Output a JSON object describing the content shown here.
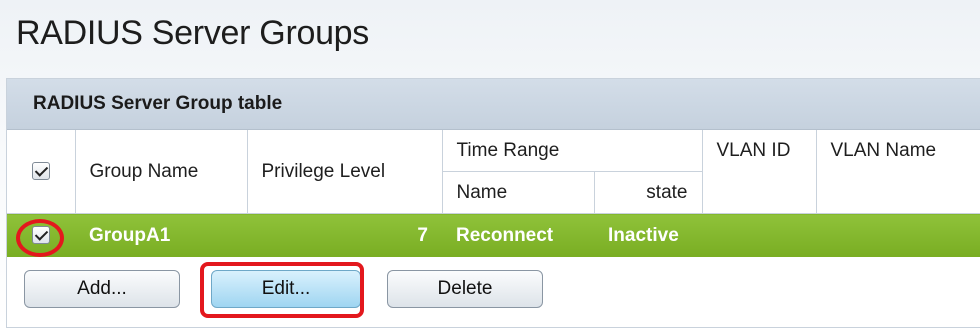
{
  "page": {
    "title": "RADIUS Server Groups"
  },
  "table": {
    "caption": "RADIUS Server Group table",
    "headers": {
      "group_name": "Group Name",
      "privilege_level": "Privilege Level",
      "time_range": "Time Range",
      "time_range_name": "Name",
      "time_range_state": "state",
      "vlan_id": "VLAN ID",
      "vlan_name": "VLAN Name"
    },
    "rows": [
      {
        "selected": true,
        "group_name": "GroupA1",
        "privilege_level": "7",
        "time_range_name": "Reconnect",
        "time_range_state": "Inactive",
        "vlan_id": "",
        "vlan_name": ""
      }
    ]
  },
  "buttons": {
    "add": "Add...",
    "edit": "Edit...",
    "delete": "Delete"
  },
  "colors": {
    "selected_row": "#85b82e",
    "caption_bar": "#ccd7e3",
    "highlight": "#e3181d",
    "active_button": "#b6e1f6"
  }
}
